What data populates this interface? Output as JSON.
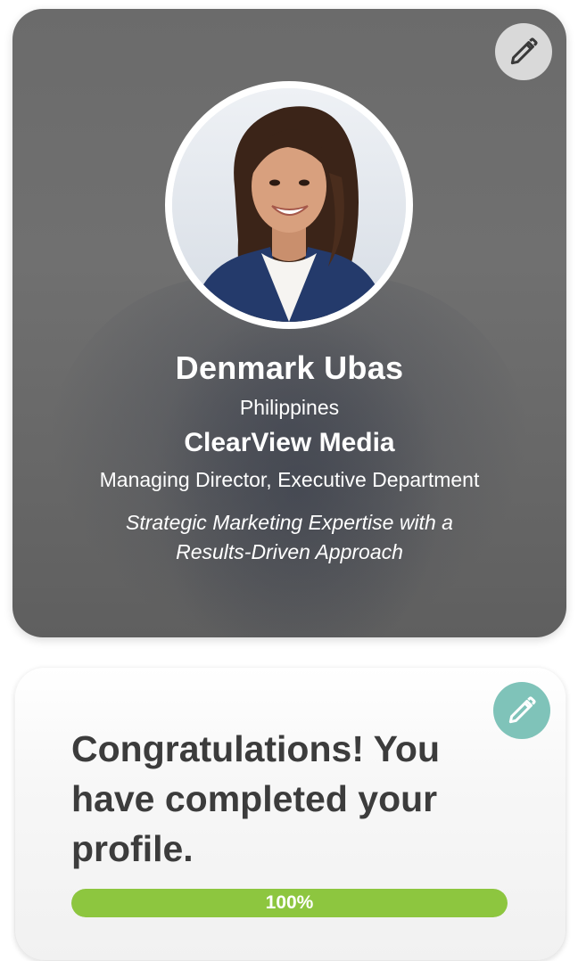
{
  "profile": {
    "name": "Denmark Ubas",
    "country": "Philippines",
    "company": "ClearView Media",
    "position": "Managing Director, Executive Department",
    "tagline_line1": "Strategic Marketing Expertise with a",
    "tagline_line2": "Results-Driven Approach",
    "edit_icon": "pencil-icon"
  },
  "completion": {
    "message": "Congratulations! You have completed your profile.",
    "progress_label": "100%",
    "progress_value": 1.0,
    "edit_icon": "pencil-icon",
    "accent_color": "#7fc3b9",
    "progress_color": "#8dc63f"
  }
}
